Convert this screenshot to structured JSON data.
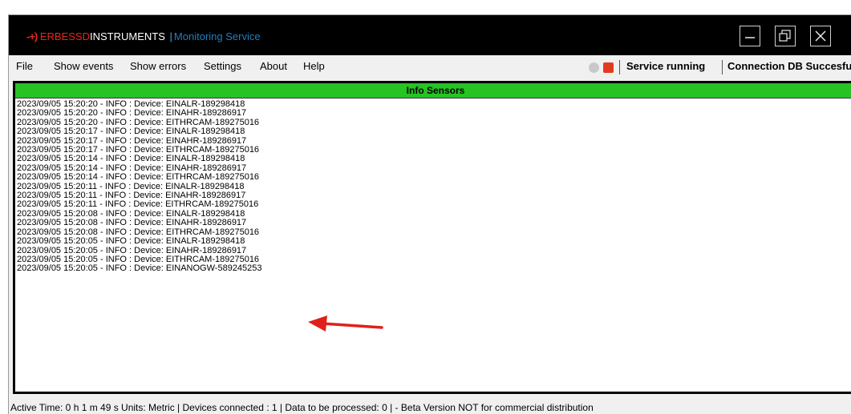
{
  "titlebar": {
    "logo_mark": "-+)",
    "brand_part1": "ERBESSD",
    "brand_part2": "INSTRUMENTS",
    "separator": "|",
    "service_name": "Monitoring Service",
    "buttons": [
      "minimize-icon",
      "restore-icon",
      "close-icon"
    ]
  },
  "menu": {
    "items": [
      "File",
      "Show events",
      "Show errors",
      "Settings",
      "About",
      "Help"
    ],
    "status_running": "Service running",
    "status_db": "Connection DB Succesful",
    "status_colors": {
      "gray": "#c9c9c9",
      "red": "#e23a1e"
    }
  },
  "panel": {
    "title": "Info Sensors",
    "header_color": "#27c224",
    "log_lines": [
      "2023/09/05 15:20:20 - INFO : Device: EINALR-189298418",
      "2023/09/05 15:20:20 - INFO : Device: EINAHR-189286917",
      "2023/09/05 15:20:20 - INFO : Device: EITHRCAM-189275016",
      "2023/09/05 15:20:17 - INFO : Device: EINALR-189298418",
      "2023/09/05 15:20:17 - INFO : Device: EINAHR-189286917",
      "2023/09/05 15:20:17 - INFO : Device: EITHRCAM-189275016",
      "2023/09/05 15:20:14 - INFO : Device: EINALR-189298418",
      "2023/09/05 15:20:14 - INFO : Device: EINAHR-189286917",
      "2023/09/05 15:20:14 - INFO : Device: EITHRCAM-189275016",
      "2023/09/05 15:20:11 - INFO : Device: EINALR-189298418",
      "2023/09/05 15:20:11 - INFO : Device: EINAHR-189286917",
      "2023/09/05 15:20:11 - INFO : Device: EITHRCAM-189275016",
      "2023/09/05 15:20:08 - INFO : Device: EINALR-189298418",
      "2023/09/05 15:20:08 - INFO : Device: EINAHR-189286917",
      "2023/09/05 15:20:08 - INFO : Device: EITHRCAM-189275016",
      "2023/09/05 15:20:05 - INFO : Device: EINALR-189298418",
      "2023/09/05 15:20:05 - INFO : Device: EINAHR-189286917",
      "2023/09/05 15:20:05 - INFO : Device: EITHRCAM-189275016",
      "2023/09/05 15:20:05 - INFO : Device: EINANOGW-589245253"
    ]
  },
  "statusbar": {
    "text": "Active Time:  0 h 1 m 49 s  Units: Metric  |  Devices connected : 1  |  Data to be processed: 0  |   - Beta Version NOT for commercial distribution"
  },
  "annotation": {
    "arrow_color": "#e0201b"
  }
}
